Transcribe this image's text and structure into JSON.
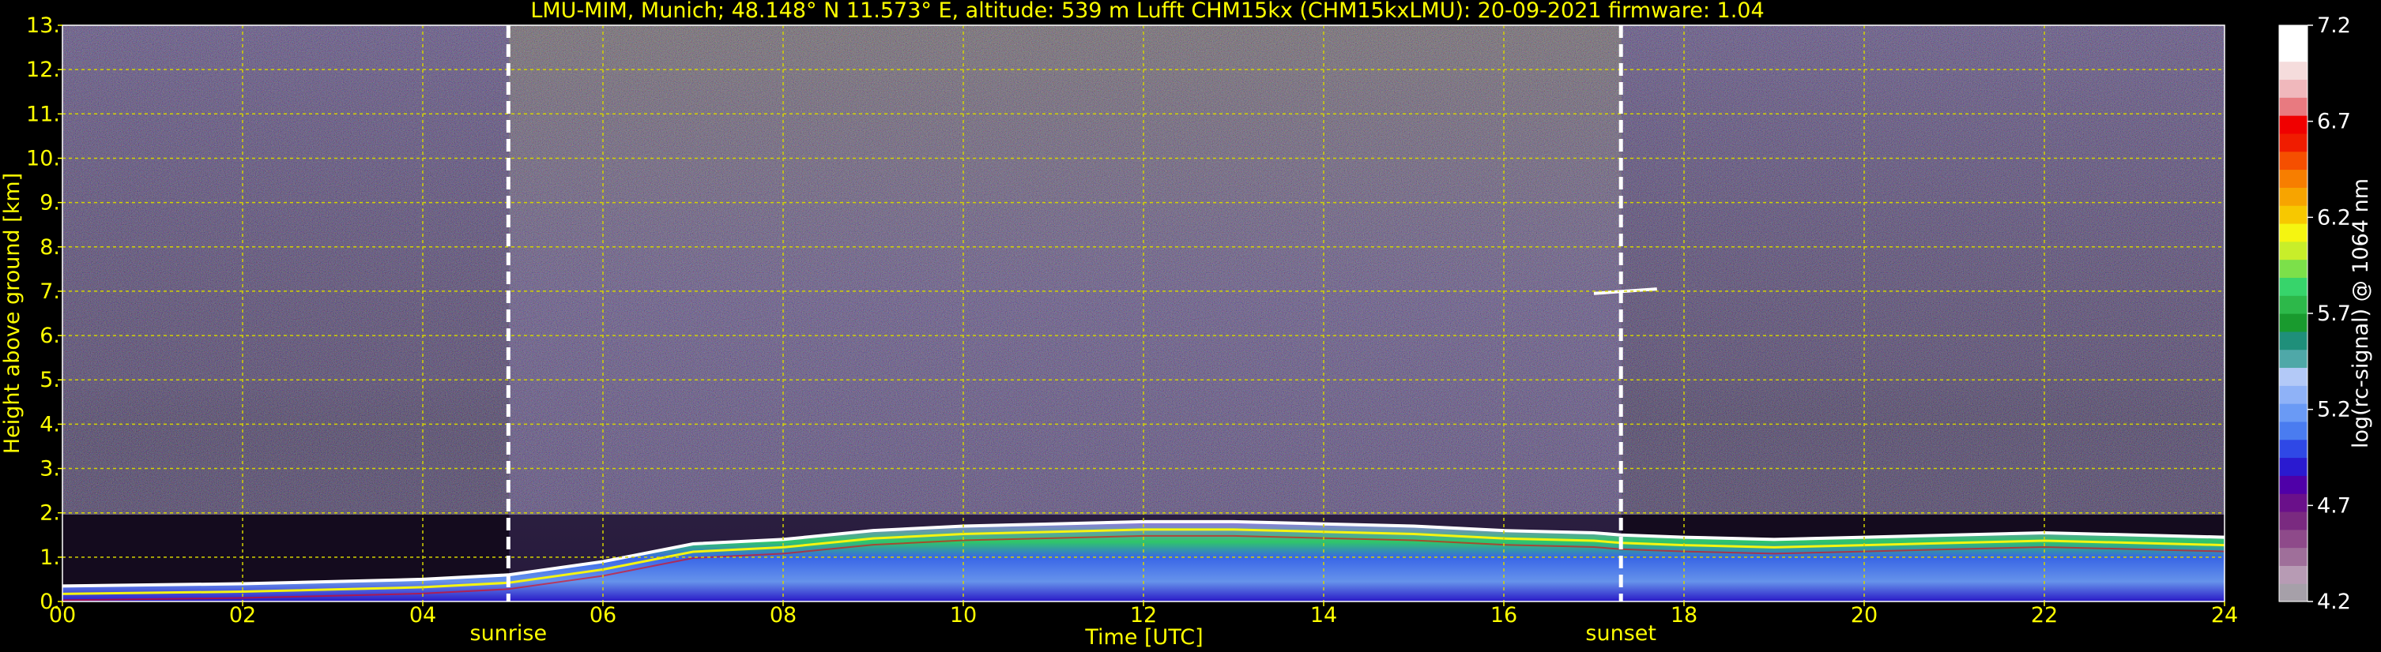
{
  "chart_data": {
    "type": "heatmap",
    "title": "LMU-MIM, Munich; 48.148° N 11.573° E, altitude: 539 m    Lufft CHM15kx (CHM15kxLMU): 20-09-2021    firmware: 1.04",
    "xlabel": "Time [UTC]",
    "ylabel": "Height above ground [km]",
    "xlim": [
      0,
      24
    ],
    "ylim": [
      0,
      13
    ],
    "x_ticks": [
      "00",
      "02",
      "04",
      "06",
      "08",
      "10",
      "12",
      "14",
      "16",
      "18",
      "20",
      "22",
      "24"
    ],
    "y_ticks": [
      "0.",
      "1.",
      "2.",
      "3.",
      "4.",
      "5.",
      "6.",
      "7.",
      "8.",
      "9.",
      "10.",
      "11.",
      "12.",
      "13."
    ],
    "grid": true,
    "events": [
      {
        "label": "sunrise",
        "x": 4.95
      },
      {
        "label": "sunset",
        "x": 17.3
      }
    ],
    "colorbar": {
      "label": "log(rc-signal) @ 1064 nm",
      "range": [
        4.2,
        7.2
      ],
      "ticks": [
        "7.2",
        "6.7",
        "6.2",
        "5.7",
        "5.2",
        "4.7",
        "4.2"
      ],
      "colors": [
        "#a6a0a9",
        "#b79bb4",
        "#9f6f9a",
        "#8e4a8a",
        "#7a2a80",
        "#6a108a",
        "#4f00a8",
        "#2a1ad0",
        "#2f48e6",
        "#4a7cf0",
        "#6a9af5",
        "#8fb2f7",
        "#b3c9f7",
        "#4fa8a8",
        "#1f8f7a",
        "#199a2e",
        "#2db84a",
        "#37d46b",
        "#7ce04a",
        "#c8ee2a",
        "#f5f511",
        "#f7c800",
        "#f7a400",
        "#f77e00",
        "#f54f00",
        "#f01c00",
        "#f00000",
        "#e87a80",
        "#f0b8bc",
        "#f5dcdc",
        "#ffffff",
        "#ffffff"
      ]
    },
    "layers": [
      {
        "name": "boundary_layer_top_km",
        "x": [
          0,
          2,
          4,
          4.95,
          6,
          7,
          8,
          9,
          10,
          11,
          12,
          13,
          14,
          15,
          16,
          17,
          17.3,
          18,
          19,
          20,
          21,
          22,
          23,
          24
        ],
        "y": [
          0.35,
          0.4,
          0.5,
          0.6,
          0.9,
          1.3,
          1.4,
          1.6,
          1.7,
          1.75,
          1.8,
          1.8,
          1.75,
          1.7,
          1.6,
          1.55,
          1.5,
          1.45,
          1.4,
          1.45,
          1.5,
          1.55,
          1.5,
          1.45
        ]
      },
      {
        "name": "cloud_layer_7km",
        "x": [
          17.0,
          17.7
        ],
        "y": [
          6.95,
          7.05
        ]
      }
    ]
  },
  "colors": {
    "text": "#ffff00",
    "grid": "#d4d400",
    "background": "#000000",
    "event_line": "#ffffff",
    "colorbar_text": "#ffffff"
  }
}
